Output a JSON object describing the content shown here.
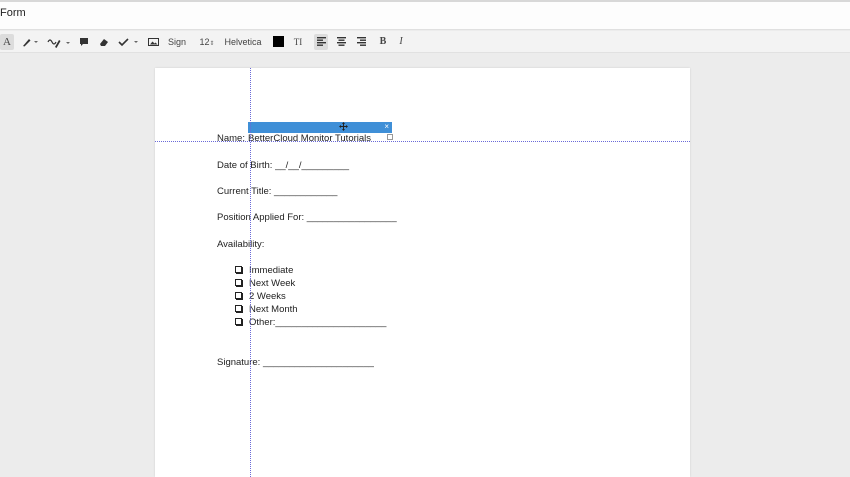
{
  "window": {
    "title": "Form"
  },
  "toolbar": {
    "sign_label": "Sign",
    "font_size": "12",
    "font_name": "Helvetica",
    "text_style_label": "TI",
    "bold_label": "B",
    "italic_label": "I",
    "text_tool_label": "A",
    "text_color": "#000000",
    "stepper_glyph": "⇕"
  },
  "form": {
    "name_label": "Name:",
    "name_value": "BetterCloud Monitor Tutorials",
    "dob_label": "Date of Birth:",
    "dob_blank": "__/__/_________",
    "title_label": "Current Title:",
    "title_blank": "____________",
    "position_label": "Position Applied For:",
    "position_blank": "_________________",
    "availability_label": "Availability:",
    "options": [
      {
        "label": "Immediate"
      },
      {
        "label": "Next Week"
      },
      {
        "label": "2 Weeks"
      },
      {
        "label": "Next Month"
      },
      {
        "label": "Other:_____________________"
      }
    ],
    "signature_label": "Signature:",
    "signature_blank": "_____________________"
  },
  "selection": {
    "close_glyph": "×"
  }
}
